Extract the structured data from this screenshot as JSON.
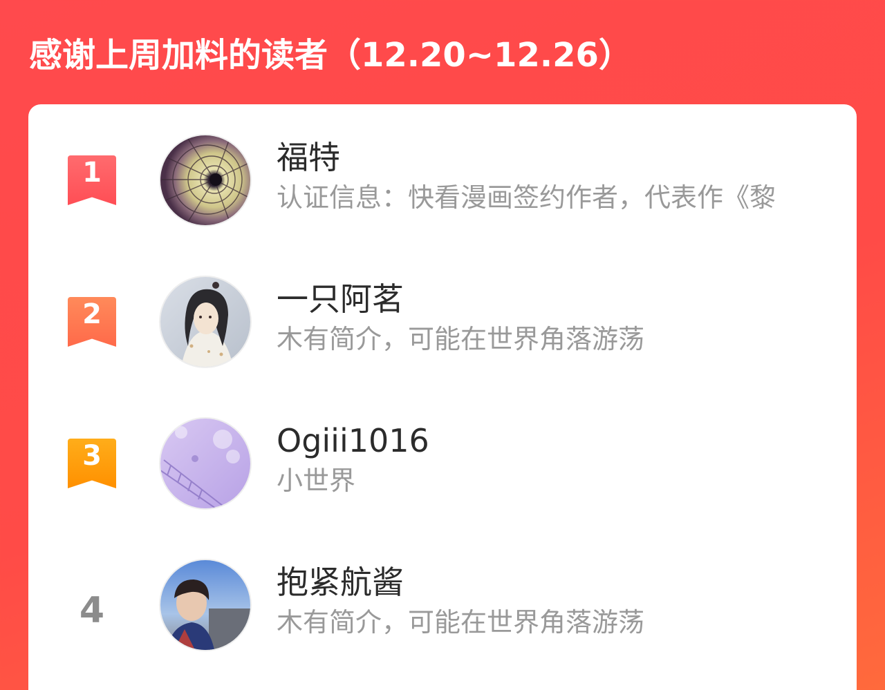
{
  "header": {
    "title": "感谢上周加料的读者（12.20~12.26）"
  },
  "colors": {
    "background_top": "#ff4a4d",
    "background_bottom": "#ff6a3c",
    "rank1": "#ff5a5e",
    "rank2": "#ff7a52",
    "rank3": "#ffa000",
    "rank_plain": "#8c8c8c",
    "name_text": "#2b2b2b",
    "bio_text": "#999999"
  },
  "readers": [
    {
      "rank": "1",
      "name": "福特",
      "bio": "认证信息：快看漫画签约作者，代表作《黎",
      "avatar_icon": "stained-glass-circle-avatar"
    },
    {
      "rank": "2",
      "name": "一只阿茗",
      "bio": "木有简介，可能在世界角落游荡",
      "avatar_icon": "anime-character-avatar"
    },
    {
      "rank": "3",
      "name": "Ogiii1016",
      "bio": "小世界",
      "avatar_icon": "purple-illustration-avatar"
    },
    {
      "rank": "4",
      "name": "抱紧航酱",
      "bio": "木有简介，可能在世界角落游荡",
      "avatar_icon": "photo-portrait-avatar"
    }
  ]
}
